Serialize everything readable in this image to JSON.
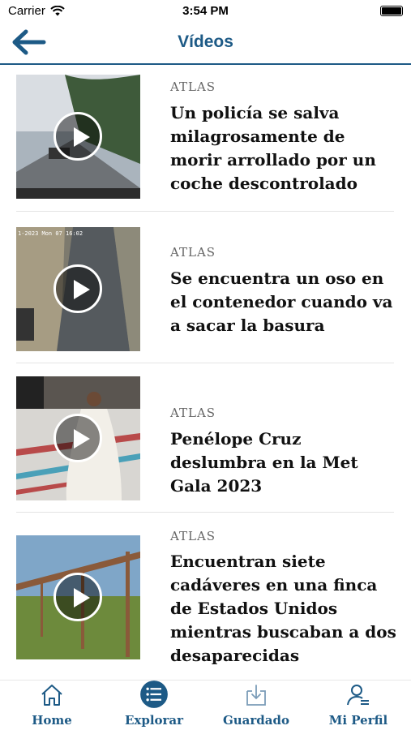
{
  "status_bar": {
    "carrier": "Carrier",
    "time": "3:54 PM"
  },
  "header": {
    "title": "Vídeos",
    "back_icon": "arrow-left-icon"
  },
  "articles": [
    {
      "section": "ATLAS",
      "title": "Un policía se salva milagrosamente de morir arrollado por un coche descontrolado"
    },
    {
      "section": "ATLAS",
      "title": "Se encuentra un oso en el contenedor cuando va a sacar la basura"
    },
    {
      "section": "ATLAS",
      "title": "Penélope Cruz deslumbra en la Met Gala 2023"
    },
    {
      "section": "ATLAS",
      "title": "Encuentran siete cadáveres en una finca de Estados Unidos mientras buscaban a dos desaparecidas"
    }
  ],
  "thumbnail_overlay_text": "1-2023 Mon 07 16:02",
  "tab_bar": {
    "items": [
      {
        "label": "Home",
        "icon": "home-icon"
      },
      {
        "label": "Explorar",
        "icon": "explore-list-icon",
        "active": true
      },
      {
        "label": "Guardado",
        "icon": "saved-download-icon"
      },
      {
        "label": "Mi Perfil",
        "icon": "profile-icon"
      }
    ]
  },
  "colors": {
    "accent": "#1d5a86",
    "section_label": "#666666",
    "divider": "#e4e4e4"
  }
}
